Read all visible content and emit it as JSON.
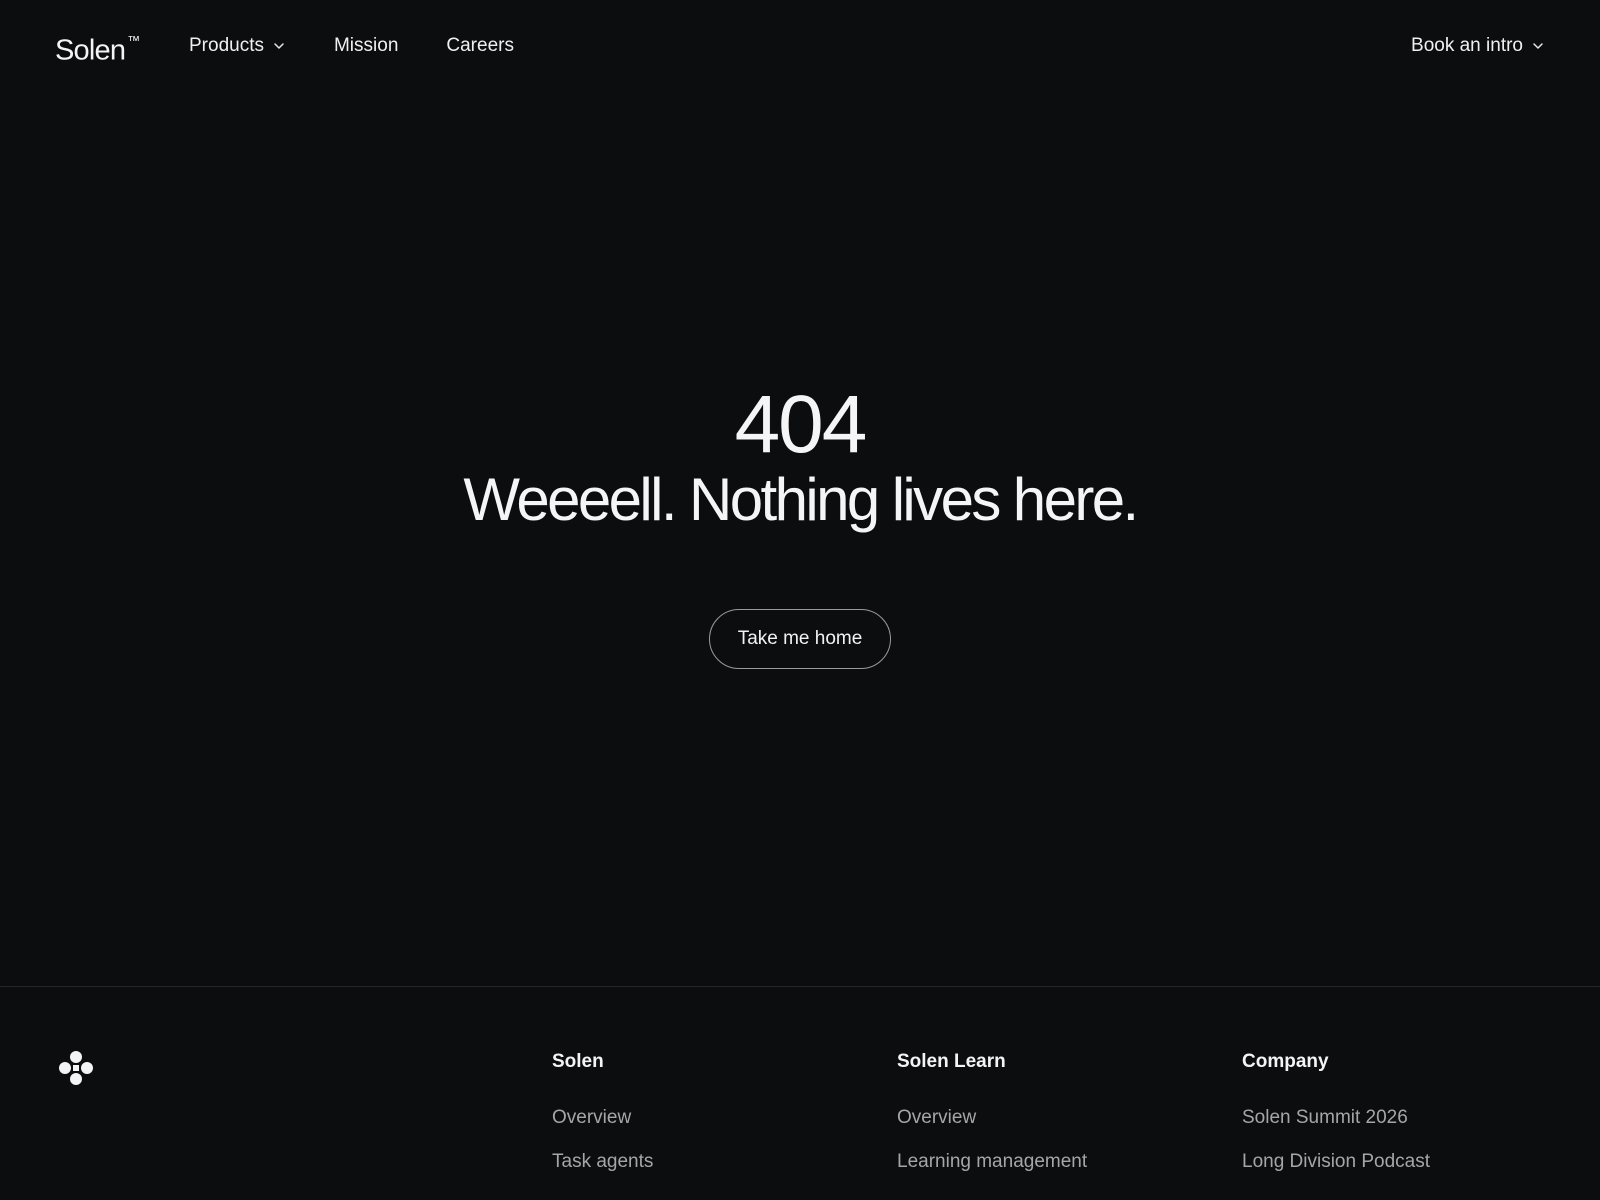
{
  "header": {
    "logo": "Solen",
    "logo_mark": "™",
    "nav": [
      {
        "label": "Products",
        "icon": "chevron-down-icon"
      },
      {
        "label": "Mission"
      },
      {
        "label": "Careers"
      }
    ],
    "cta": {
      "label": "Book an intro",
      "icon": "chevron-down-icon"
    }
  },
  "hero": {
    "code": "404",
    "headline": "Weeeell. Nothing lives here.",
    "button": "Take me home"
  },
  "footer": {
    "logo_icon": "dots-cluster-icon",
    "columns": [
      {
        "title": "Solen",
        "links": [
          "Overview",
          "Task agents"
        ]
      },
      {
        "title": "Solen Learn",
        "links": [
          "Overview",
          "Learning management"
        ]
      },
      {
        "title": "Company",
        "links": [
          "Solen Summit 2026",
          "Long Division Podcast"
        ]
      }
    ]
  },
  "colors": {
    "background": "#0c0d0f",
    "text": "#f2f2f2",
    "muted": "#a5a6a9",
    "border": "#9a9a9c"
  }
}
